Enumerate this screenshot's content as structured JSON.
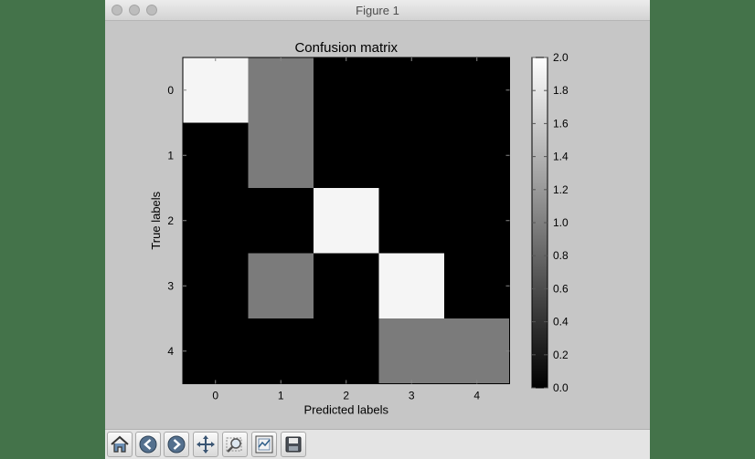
{
  "window": {
    "title": "Figure 1"
  },
  "toolbar": {
    "buttons": [
      {
        "icon": "home-icon"
      },
      {
        "icon": "back-icon"
      },
      {
        "icon": "forward-icon"
      },
      {
        "icon": "pan-icon"
      },
      {
        "icon": "zoom-icon"
      },
      {
        "icon": "subplots-icon"
      },
      {
        "icon": "save-icon"
      }
    ]
  },
  "chart_data": {
    "type": "heatmap",
    "title": "Confusion matrix",
    "xlabel": "Predicted labels",
    "ylabel": "True labels",
    "x_categories": [
      "0",
      "1",
      "2",
      "3",
      "4"
    ],
    "y_categories": [
      "0",
      "1",
      "2",
      "3",
      "4"
    ],
    "matrix": [
      [
        2,
        1,
        0,
        0,
        0
      ],
      [
        0,
        1,
        0,
        0,
        0
      ],
      [
        0,
        0,
        2,
        0,
        0
      ],
      [
        0,
        1,
        0,
        2,
        0
      ],
      [
        0,
        0,
        0,
        1,
        1
      ]
    ],
    "colormap": "gray",
    "colorbar": {
      "min": 0.0,
      "max": 2.0,
      "ticks": [
        "0.0",
        "0.2",
        "0.4",
        "0.6",
        "0.8",
        "1.0",
        "1.2",
        "1.4",
        "1.6",
        "1.8",
        "2.0"
      ]
    }
  }
}
